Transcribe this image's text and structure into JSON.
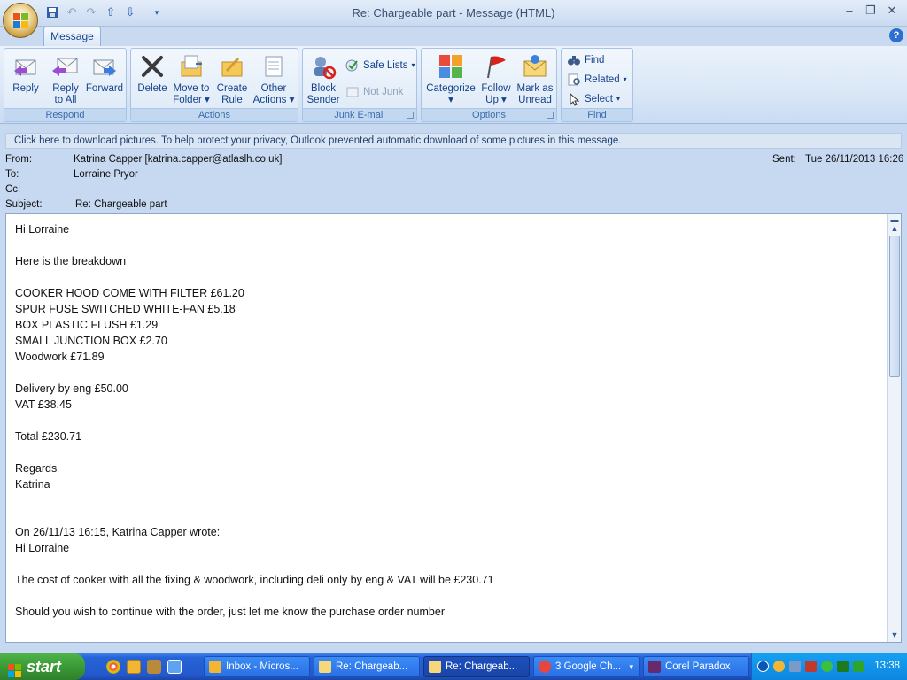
{
  "window": {
    "title": "Re: Chargeable part - Message (HTML)",
    "tab": "Message",
    "help": "?"
  },
  "ribbon": {
    "respond": {
      "label": "Respond",
      "reply": "Reply",
      "reply_all_1": "Reply",
      "reply_all_2": "to All",
      "forward": "Forward"
    },
    "actions": {
      "label": "Actions",
      "delete": "Delete",
      "move_1": "Move to",
      "move_2": "Folder",
      "create_rule_1": "Create",
      "create_rule_2": "Rule",
      "other_1": "Other",
      "other_2": "Actions"
    },
    "junk": {
      "label": "Junk E-mail",
      "block_1": "Block",
      "block_2": "Sender",
      "safe_lists": "Safe Lists",
      "not_junk": "Not Junk"
    },
    "options": {
      "label": "Options",
      "categorize": "Categorize",
      "follow_1": "Follow",
      "follow_2": "Up",
      "mark_1": "Mark as",
      "mark_2": "Unread"
    },
    "find": {
      "label": "Find",
      "find": "Find",
      "related": "Related",
      "select": "Select"
    }
  },
  "infobar": "Click here to download pictures. To help protect your privacy, Outlook prevented automatic download of some pictures in this message.",
  "header": {
    "from_label": "From:",
    "from": "Katrina Capper [katrina.capper@atlaslh.co.uk]",
    "to_label": "To:",
    "to": "Lorraine Pryor",
    "cc_label": "Cc:",
    "cc": "",
    "subject_label": "Subject:",
    "subject": "Re: Chargeable part",
    "sent_label": "Sent:",
    "sent": "Tue 26/11/2013 16:26"
  },
  "body": {
    "lines": [
      "Hi Lorraine",
      "",
      "Here is the breakdown",
      "",
      "COOKER HOOD COME WITH FILTER £61.20",
      "SPUR FUSE SWITCHED WHITE-FAN £5.18",
      "BOX PLASTIC FLUSH £1.29",
      "SMALL JUNCTION BOX £2.70",
      "Woodwork £71.89",
      "",
      "Delivery by eng £50.00",
      "VAT £38.45",
      "",
      "Total £230.71",
      "",
      "Regards",
      "Katrina",
      "",
      "",
      "On 26/11/13 16:15, Katrina Capper wrote:",
      "Hi Lorraine",
      "",
      "The cost of cooker with all the fixing & woodwork, including deli only by eng & VAT will be £230.71",
      "",
      "Should you wish to continue with the order, just let me know the purchase order number"
    ]
  },
  "taskbar": {
    "start": "start",
    "items": [
      "Inbox - Micros...",
      "Re: Chargeab...",
      "Re: Chargeab...",
      "3 Google Ch...",
      "Corel Paradox"
    ],
    "clock": "13:38"
  },
  "colors": {
    "ribbon_text": "#15428b",
    "taskbar": "#2459cc",
    "start": "#3a9b35"
  }
}
